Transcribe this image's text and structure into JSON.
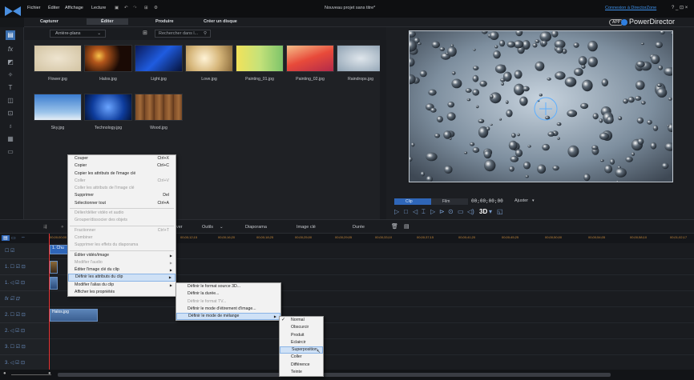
{
  "menubar": {
    "items": [
      "Fichier",
      "Éditer",
      "Affichage",
      "Lecture"
    ],
    "project_title": "Nouveau projet sans titre*",
    "directorzone": "Connexion à DirectorZone",
    "win_controls": "? _ ⊡ ×"
  },
  "modes": [
    "Capturer",
    "Éditer",
    "Produire",
    "Créer un disque"
  ],
  "brand": {
    "badge": "APP",
    "name": "PowerDirector"
  },
  "library": {
    "dropdown": "Arrière-plans",
    "search_placeholder": "Rechercher dans l...",
    "items": [
      {
        "name": "Flower.jpg"
      },
      {
        "name": "Halos.jpg"
      },
      {
        "name": "Light.jpg"
      },
      {
        "name": "Love.jpg"
      },
      {
        "name": "Painting_01.jpg"
      },
      {
        "name": "Painting_02.jpg"
      },
      {
        "name": "Raindrops.jpg"
      },
      {
        "name": "Sky.jpg"
      },
      {
        "name": "Technology.jpg"
      },
      {
        "name": "Wood.jpg"
      }
    ]
  },
  "preview": {
    "clip_label": "Clip",
    "film_label": "Film",
    "timecode": "00;00;00;00",
    "fit_label": "Ajuster",
    "threed": "3D"
  },
  "timeline_toolbar": {
    "tabs": [
      "Outils",
      "Diaporama",
      "Image clé",
      "Durée"
    ],
    "cut_label": "ver"
  },
  "ruler": {
    "ticks": [
      "00;00;00;00",
      "00;00;12;15",
      "00;00;16;20",
      "00;00;18;25",
      "00;00;25;00",
      "00;00;29;05",
      "00;00;33;10",
      "00;00;37;15",
      "00;00;41;20",
      "00;00;45;25",
      "00;00;50;00",
      "00;00;54;05",
      "00;00;58;10",
      "00;01;02;17"
    ]
  },
  "tracks": {
    "clip_label": "1. Chu",
    "image_clip": "Halos.jpg",
    "heads": [
      "1.",
      "1.",
      "1.",
      "fx",
      "2.",
      "2.",
      "3.",
      "3.",
      "T"
    ]
  },
  "context_menu": {
    "items": [
      {
        "label": "Couper",
        "shortcut": "Ctrl+X",
        "disabled": false
      },
      {
        "label": "Copier",
        "shortcut": "Ctrl+C",
        "disabled": false
      },
      {
        "label": "Copier les attributs de l'image clé",
        "shortcut": "",
        "disabled": false
      },
      {
        "label": "Coller",
        "shortcut": "Ctrl+V",
        "disabled": true
      },
      {
        "label": "Coller les attributs de l'image clé",
        "shortcut": "",
        "disabled": true
      },
      {
        "label": "Supprimer",
        "shortcut": "Del",
        "disabled": false
      },
      {
        "label": "Sélectionner tout",
        "shortcut": "Ctrl+A",
        "disabled": false
      },
      {
        "label": "Délier/délier vidéo et audio",
        "shortcut": "",
        "disabled": true
      },
      {
        "label": "Grouper/dissocier des objets",
        "shortcut": "",
        "disabled": true
      },
      {
        "label": "Fractionner",
        "shortcut": "Ctrl+T",
        "disabled": true
      },
      {
        "label": "Combiner",
        "shortcut": "",
        "disabled": true
      },
      {
        "label": "Supprimer les effets du diaporama",
        "shortcut": "",
        "disabled": true
      },
      {
        "label": "Éditer vidéo/image",
        "shortcut": "",
        "disabled": false,
        "sub": true
      },
      {
        "label": "Modifier l'audio",
        "shortcut": "",
        "disabled": true,
        "sub": true
      },
      {
        "label": "Éditer l'image clé du clip",
        "shortcut": "",
        "disabled": false,
        "sub": true
      },
      {
        "label": "Définir les attributs du clip",
        "shortcut": "",
        "disabled": false,
        "sub": true,
        "highlight": true
      },
      {
        "label": "Modifier l'alias du clip",
        "shortcut": "",
        "disabled": false,
        "sub": true
      },
      {
        "label": "Afficher les propriétés",
        "shortcut": "",
        "disabled": false
      }
    ]
  },
  "submenu1": {
    "items": [
      {
        "label": "Définir le format source 3D...",
        "disabled": false
      },
      {
        "label": "Définir la durée...",
        "disabled": false
      },
      {
        "label": "Définir le format TV...",
        "disabled": true
      },
      {
        "label": "Définir le mode d'étirement d'image...",
        "disabled": false
      },
      {
        "label": "Définir le mode de mélange",
        "disabled": false,
        "sub": true,
        "highlight": true
      }
    ]
  },
  "submenu2": {
    "items": [
      {
        "label": "Normal",
        "checked": true
      },
      {
        "label": "Obscurcir",
        "checked": false
      },
      {
        "label": "Produit",
        "checked": false
      },
      {
        "label": "Eclaircir",
        "checked": false
      },
      {
        "label": "Superposition",
        "checked": false,
        "highlight": true
      },
      {
        "label": "Coller",
        "checked": false
      },
      {
        "label": "Différence",
        "checked": false
      },
      {
        "label": "Teinte",
        "checked": false
      }
    ]
  }
}
